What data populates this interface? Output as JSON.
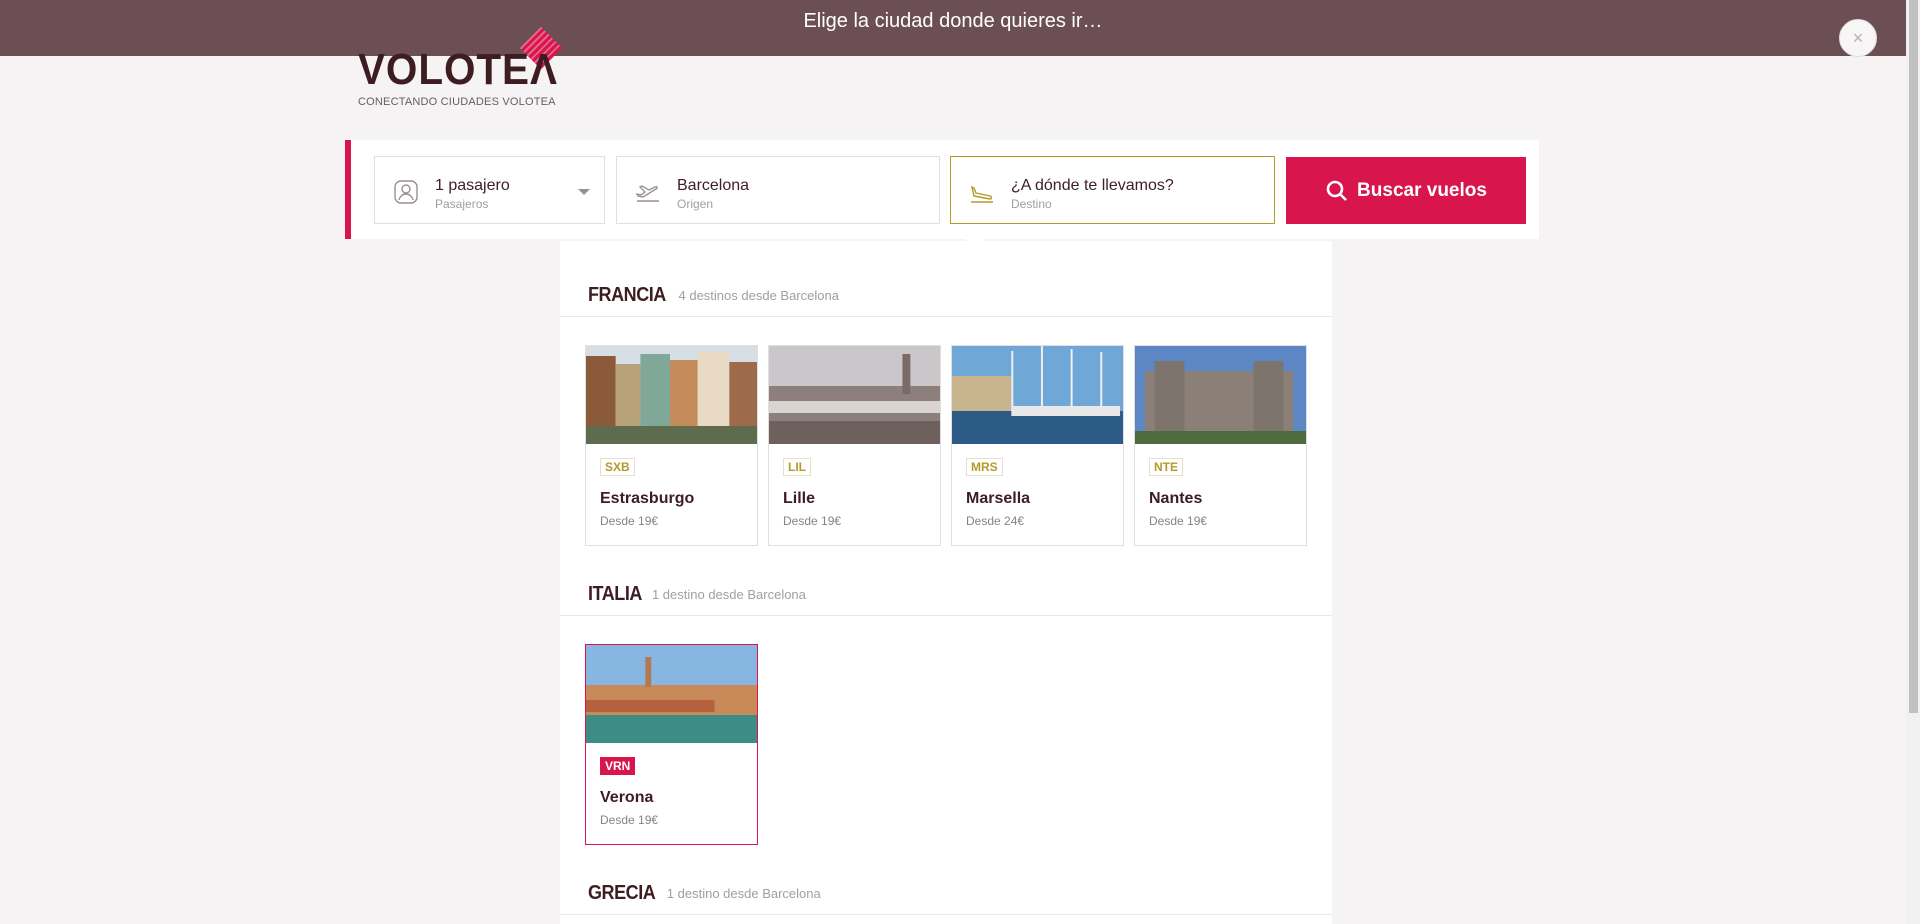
{
  "banner": {
    "text": "Elige la ciudad donde quieres ir…",
    "close_label": "×"
  },
  "logo": {
    "wordmark": "VOLOTEΛ",
    "tagline": "CONECTANDO CIUDADES VOLOTEA"
  },
  "search": {
    "passengers": {
      "value": "1 pasajero",
      "label": "Pasajeros"
    },
    "origin": {
      "value": "Barcelona",
      "label": "Origen"
    },
    "destination": {
      "placeholder": "¿A dónde te llevamos?",
      "label": "Destino"
    },
    "button_label": "Buscar vuelos"
  },
  "countries": [
    {
      "name": "FRANCIA",
      "count": "4 destinos desde Barcelona",
      "destinations": [
        {
          "iata": "SXB",
          "city": "Estrasburgo",
          "price": "Desde 19€"
        },
        {
          "iata": "LIL",
          "city": "Lille",
          "price": "Desde 19€"
        },
        {
          "iata": "MRS",
          "city": "Marsella",
          "price": "Desde 24€"
        },
        {
          "iata": "NTE",
          "city": "Nantes",
          "price": "Desde 19€"
        }
      ]
    },
    {
      "name": "ITALIA",
      "count": "1 destino desde Barcelona",
      "destinations": [
        {
          "iata": "VRN",
          "city": "Verona",
          "price": "Desde 19€",
          "selected": true
        }
      ]
    },
    {
      "name": "GRECIA",
      "count": "1 destino desde Barcelona",
      "destinations": []
    }
  ],
  "colors": {
    "brand": "#d8154c",
    "banner": "#6b4f55",
    "accent_gold": "#b59a2a"
  }
}
